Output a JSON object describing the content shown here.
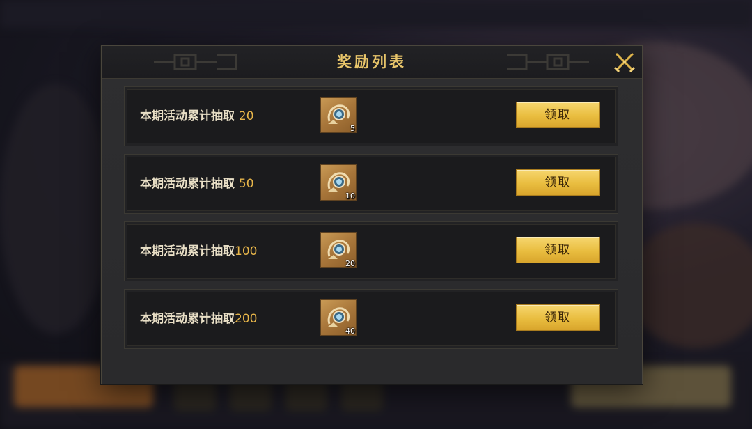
{
  "dialog": {
    "title": "奖励列表",
    "close_icon": "crossed-swords-close-icon"
  },
  "rewards": [
    {
      "label": "本期活动累计抽取",
      "threshold": "20",
      "item_icon": "amulet-compass-icon",
      "count": "5",
      "button": "领取"
    },
    {
      "label": "本期活动累计抽取",
      "threshold": "50",
      "item_icon": "amulet-compass-icon",
      "count": "10",
      "button": "领取"
    },
    {
      "label": "本期活动累计抽取",
      "threshold": "100",
      "item_icon": "amulet-compass-icon",
      "count": "20",
      "button": "领取"
    },
    {
      "label": "本期活动累计抽取",
      "threshold": "200",
      "item_icon": "amulet-compass-icon",
      "count": "40",
      "button": "领取"
    }
  ],
  "colors": {
    "title": "#e8c56a",
    "threshold": "#e8b64a",
    "button": "#e9bd3f"
  }
}
